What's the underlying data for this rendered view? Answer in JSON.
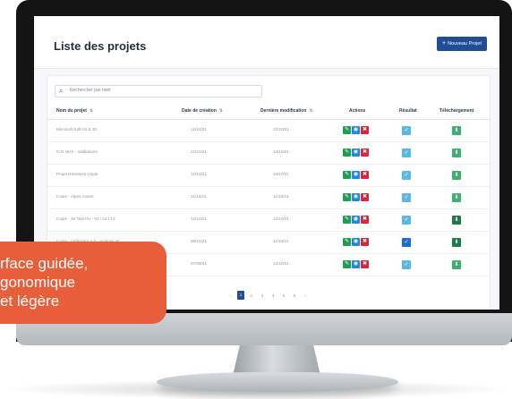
{
  "header": {
    "title": "Liste des projets",
    "new_button": "Nouveau Projet"
  },
  "search": {
    "placeholder": "Rechercher par nom"
  },
  "table": {
    "columns": [
      "Nom du projet",
      "Date de création",
      "Dernière modification",
      "Actions",
      "Résultat",
      "Téléchargement"
    ],
    "rows": [
      {
        "name": "Microsoft Edit 04 & 10",
        "created": "12/10/21",
        "modified": "12/10/21",
        "result_color": "#5bb8e6",
        "download_color": "#3fae6f"
      },
      {
        "name": "ICO-NHS - Validations",
        "created": "12/10/21",
        "modified": "12/10/21",
        "result_color": "#5bb8e6",
        "download_color": "#3fae6f"
      },
      {
        "name": "Projet Révisions Copie",
        "created": "12/10/21",
        "modified": "12/10/21",
        "result_color": "#5bb8e6",
        "download_color": "#3fae6f"
      },
      {
        "name": "Copie - Alpes routes",
        "created": "11/10/21",
        "modified": "11/10/21",
        "result_color": "#5bb8e6",
        "download_color": "#3fae6f"
      },
      {
        "name": "Copie - 3e Test HV - 04 / 12 / 13",
        "created": "12/10/21",
        "modified": "12/10/21",
        "result_color": "#5bb8e6",
        "download_color": "#1f7a4a"
      },
      {
        "name": "Copie - Utilisateur 4.0 - Analyse 4C",
        "created": "09/10/21",
        "modified": "11/10/21",
        "result_color": "#1e6fc7",
        "download_color": "#1f7a4a"
      },
      {
        "name": "Copie - Cantons Test",
        "created": "07/09/21",
        "modified": "12/10/21",
        "result_color": "#5bb8e6",
        "download_color": "#3fae6f"
      }
    ]
  },
  "pagination": {
    "pages": [
      "‹",
      "1",
      "2",
      "3",
      "4",
      "5",
      "6",
      "›"
    ],
    "active": "1"
  },
  "callout": {
    "text": "rface guidée,\ngonomique\net légère"
  },
  "colors": {
    "accent": "#1f4e96",
    "callout": "#e85e3a"
  }
}
